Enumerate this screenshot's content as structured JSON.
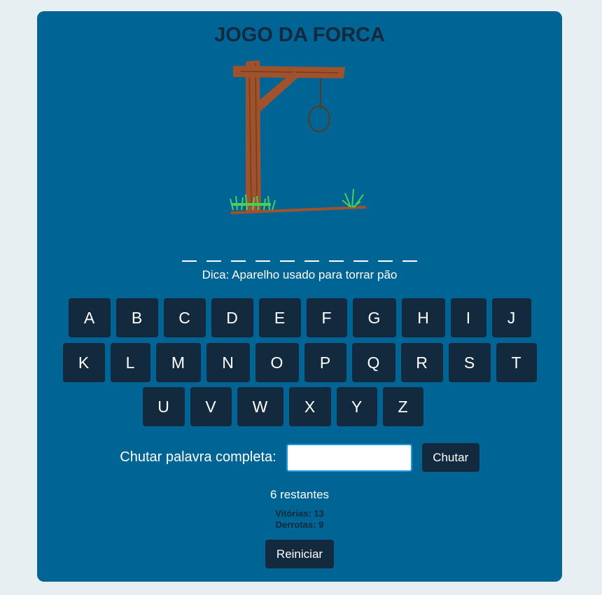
{
  "title": "JOGO DA FORCA",
  "word_length": 10,
  "hint": "Dica: Aparelho usado para torrar pão",
  "keyboard": {
    "rows": [
      [
        "A",
        "B",
        "C",
        "D",
        "E",
        "F",
        "G",
        "H",
        "I",
        "J"
      ],
      [
        "K",
        "L",
        "M",
        "N",
        "O",
        "P",
        "Q",
        "R",
        "S",
        "T"
      ],
      [
        "U",
        "V",
        "W",
        "X",
        "Y",
        "Z"
      ]
    ]
  },
  "guess": {
    "label": "Chutar palavra completa:",
    "input_value": "",
    "button_label": "Chutar"
  },
  "remaining": "6 restantes",
  "stats": {
    "wins": "Vitórias: 13",
    "losses": "Derrotas: 9"
  },
  "restart_label": "Reiniciar",
  "colors": {
    "page_bg": "#e8eff2",
    "card_bg": "#006494",
    "button_bg": "#13293d",
    "gallows": "#a0522d",
    "grass": "#4ccf5a",
    "input_border": "#1b98e0"
  },
  "icons": {
    "gallows": "gallows-illustration"
  }
}
